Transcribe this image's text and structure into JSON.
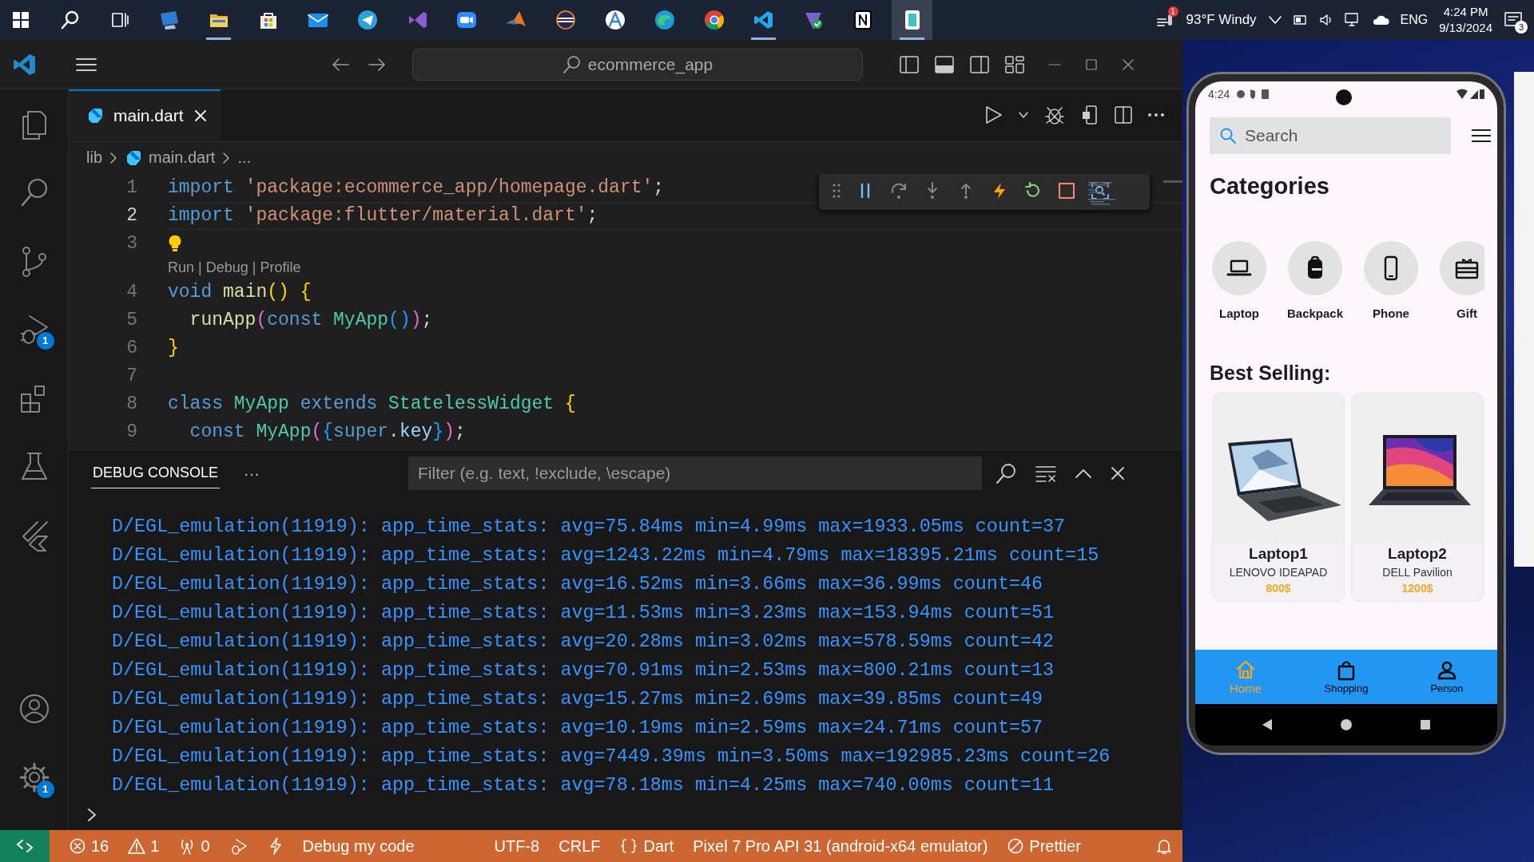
{
  "taskbar": {
    "apps": [
      {
        "kind": "start",
        "running": false,
        "selected": false
      },
      {
        "kind": "search",
        "running": false,
        "selected": false
      },
      {
        "kind": "taskview",
        "running": false,
        "selected": false
      },
      {
        "kind": "desktop",
        "running": false,
        "selected": false
      },
      {
        "kind": "folder",
        "running": true,
        "selected": false
      },
      {
        "kind": "store",
        "running": false,
        "selected": false
      },
      {
        "kind": "mail",
        "running": false,
        "selected": false
      },
      {
        "kind": "telegram",
        "running": false,
        "selected": false
      },
      {
        "kind": "visualstudio",
        "running": false,
        "selected": false
      },
      {
        "kind": "zoom",
        "running": false,
        "selected": false
      },
      {
        "kind": "matlab",
        "running": false,
        "selected": false
      },
      {
        "kind": "eclipse",
        "running": false,
        "selected": false
      },
      {
        "kind": "androidstudio",
        "running": false,
        "selected": false
      },
      {
        "kind": "edge",
        "running": false,
        "selected": false
      },
      {
        "kind": "chrome",
        "running": false,
        "selected": false
      },
      {
        "kind": "vscode",
        "running": true,
        "selected": false
      },
      {
        "kind": "shield",
        "running": false,
        "selected": false
      },
      {
        "kind": "notion",
        "running": false,
        "selected": false
      },
      {
        "kind": "emulator",
        "running": true,
        "selected": true
      }
    ],
    "weather": "93°F  Windy",
    "language": "ENG",
    "time": "4:24 PM",
    "date": "9/13/2024",
    "notifications": "3",
    "alert_badge": "1"
  },
  "window": {
    "title": "ecommerce_app"
  },
  "activity_bar": {
    "items": [
      {
        "kind": "explorer"
      },
      {
        "kind": "search"
      },
      {
        "kind": "source_control"
      },
      {
        "kind": "run_debug",
        "badge": "1"
      },
      {
        "kind": "extensions"
      },
      {
        "kind": "testing"
      },
      {
        "kind": "flutter"
      }
    ],
    "bottom": [
      {
        "kind": "account"
      },
      {
        "kind": "settings",
        "badge": "1"
      }
    ]
  },
  "tabs": [
    {
      "label": "main.dart",
      "selected": true
    }
  ],
  "breadcrumb": [
    "lib",
    "main.dart",
    "..."
  ],
  "editor": {
    "lines": [
      {
        "kind": "code",
        "number": "1",
        "current": false,
        "lightbulb": false,
        "tokens": [
          {
            "text": "import",
            "color": "#569cd6"
          },
          {
            "text": " 'package:ecommerce_app/homepage.dart'",
            "color": "#ce9178"
          },
          {
            "text": ";",
            "color": "#d4d4d4"
          }
        ]
      },
      {
        "kind": "code",
        "number": "2",
        "current": true,
        "lightbulb": false,
        "tokens": [
          {
            "text": "import",
            "color": "#569cd6"
          },
          {
            "text": " 'package:flutter/material.dart'",
            "color": "#ce9178"
          },
          {
            "text": ";",
            "color": "#d4d4d4"
          }
        ]
      },
      {
        "kind": "code",
        "number": "3",
        "current": false,
        "lightbulb": true
      },
      {
        "kind": "codelens",
        "text": "Run | Debug | Profile"
      },
      {
        "kind": "code",
        "number": "4",
        "current": false,
        "lightbulb": false,
        "tokens": [
          {
            "text": "void",
            "color": "#569cd6"
          },
          {
            "text": " main",
            "color": "#dcdcaa"
          },
          {
            "text": "()",
            "color": "#ffd700"
          },
          {
            "text": " {",
            "color": "#ffd700"
          }
        ]
      },
      {
        "kind": "code",
        "number": "5",
        "current": false,
        "lightbulb": false,
        "tokens": [
          {
            "text": "  runApp",
            "color": "#dcdcaa"
          },
          {
            "text": "(",
            "color": "#da70d6"
          },
          {
            "text": "const",
            "color": "#569cd6"
          },
          {
            "text": " MyApp",
            "color": "#4ec9b0"
          },
          {
            "text": "()",
            "color": "#179fff"
          },
          {
            "text": ")",
            "color": "#da70d6"
          },
          {
            "text": ";",
            "color": "#d4d4d4"
          }
        ]
      },
      {
        "kind": "code",
        "number": "6",
        "current": false,
        "lightbulb": false,
        "tokens": [
          {
            "text": "}",
            "color": "#ffd700"
          }
        ]
      },
      {
        "kind": "code",
        "number": "7",
        "current": false,
        "lightbulb": false
      },
      {
        "kind": "code",
        "number": "8",
        "current": false,
        "lightbulb": false,
        "tokens": [
          {
            "text": "class",
            "color": "#569cd6"
          },
          {
            "text": " MyApp",
            "color": "#4ec9b0"
          },
          {
            "text": " extends",
            "color": "#569cd6"
          },
          {
            "text": " StatelessWidget",
            "color": "#4ec9b0"
          },
          {
            "text": " {",
            "color": "#ffd700"
          }
        ]
      },
      {
        "kind": "code",
        "number": "9",
        "current": false,
        "lightbulb": false,
        "tokens": [
          {
            "text": "  const",
            "color": "#569cd6"
          },
          {
            "text": " MyApp",
            "color": "#4ec9b0"
          },
          {
            "text": "(",
            "color": "#da70d6"
          },
          {
            "text": "{",
            "color": "#179fff"
          },
          {
            "text": "super",
            "color": "#569cd6"
          },
          {
            "text": ".",
            "color": "#d4d4d4"
          },
          {
            "text": "key",
            "color": "#9cdcfe"
          },
          {
            "text": "}",
            "color": "#179fff"
          },
          {
            "text": ")",
            "color": "#da70d6"
          },
          {
            "text": ";",
            "color": "#d4d4d4"
          }
        ]
      }
    ]
  },
  "panel": {
    "tabs": [
      {
        "label": "DEBUG CONSOLE",
        "selected": true
      }
    ],
    "more": "···",
    "filter": {
      "placeholder": "Filter (e.g. text, !exclude, \\escape)"
    },
    "lines": [
      "D/EGL_emulation(11919): app_time_stats: avg=75.84ms min=4.99ms max=1933.05ms count=37",
      "D/EGL_emulation(11919): app_time_stats: avg=1243.22ms min=4.79ms max=18395.21ms count=15",
      "D/EGL_emulation(11919): app_time_stats: avg=16.52ms min=3.66ms max=36.99ms count=46",
      "D/EGL_emulation(11919): app_time_stats: avg=11.53ms min=3.23ms max=153.94ms count=51",
      "D/EGL_emulation(11919): app_time_stats: avg=20.28ms min=3.02ms max=578.59ms count=42",
      "D/EGL_emulation(11919): app_time_stats: avg=70.91ms min=2.53ms max=800.21ms count=13",
      "D/EGL_emulation(11919): app_time_stats: avg=15.27ms min=2.69ms max=39.85ms count=49",
      "D/EGL_emulation(11919): app_time_stats: avg=10.19ms min=2.59ms max=24.71ms count=57",
      "D/EGL_emulation(11919): app_time_stats: avg=7449.39ms min=3.50ms max=192985.23ms count=26",
      "D/EGL_emulation(11919): app_time_stats: avg=78.18ms min=4.25ms max=740.00ms count=11"
    ]
  },
  "status_bar": {
    "items": [
      {
        "kind": "errors",
        "text": "16"
      },
      {
        "kind": "warnings",
        "text": "1"
      },
      {
        "kind": "ports",
        "text": "0"
      },
      {
        "kind": "debug"
      },
      {
        "kind": "flash"
      },
      {
        "kind": "plain",
        "text": "Debug my code"
      },
      {
        "kind": "spacer"
      },
      {
        "kind": "plain",
        "text": "UTF-8"
      },
      {
        "kind": "plain",
        "text": "CRLF"
      },
      {
        "kind": "braces",
        "text": "Dart"
      },
      {
        "kind": "plain",
        "text": "Pixel 7 Pro API 31 (android-x64 emulator)"
      },
      {
        "kind": "prettier",
        "text": "Prettier"
      },
      {
        "kind": "bell"
      }
    ]
  },
  "phone": {
    "time": "4:24",
    "search": {
      "placeholder": "Search"
    },
    "categories_title": "Categories",
    "categories": [
      {
        "kind": "laptop",
        "label": "Laptop"
      },
      {
        "kind": "backpack",
        "label": "Backpack"
      },
      {
        "kind": "phone",
        "label": "Phone"
      },
      {
        "kind": "gift",
        "label": "Gift"
      }
    ],
    "best_selling_title": "Best Selling:",
    "products": [
      {
        "name": "Laptop1",
        "brand": "LENOVO IDEAPAD",
        "price": "800$"
      },
      {
        "name": "Laptop2",
        "brand": "DELL Pavilion",
        "price": "1200$"
      }
    ],
    "nav": [
      {
        "kind": "home",
        "label": "Home",
        "selected": true
      },
      {
        "kind": "shopping",
        "label": "Shopping",
        "selected": false
      },
      {
        "kind": "person",
        "label": "Person",
        "selected": false
      }
    ]
  }
}
